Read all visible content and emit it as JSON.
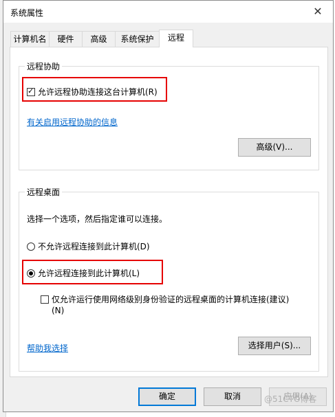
{
  "window": {
    "title": "系统属性",
    "close_glyph": "✕"
  },
  "tabs": [
    {
      "label": "计算机名"
    },
    {
      "label": "硬件"
    },
    {
      "label": "高级"
    },
    {
      "label": "系统保护"
    },
    {
      "label": "远程"
    }
  ],
  "remote_assistance": {
    "group_title": "远程协助",
    "allow_label": "允许远程协助连接这台计算机(R)",
    "allow_checked": true,
    "info_link": "有关启用远程协助的信息",
    "advanced_button": "高级(V)..."
  },
  "remote_desktop": {
    "group_title": "远程桌面",
    "instruction": "选择一个选项，然后指定谁可以连接。",
    "option_deny": "不允许远程连接到此计算机(D)",
    "option_allow": "允许远程连接到此计算机(L)",
    "selected": "allow",
    "nla_label_line1": "仅允许运行使用网络级别身份验证的远程桌面的计算机连接(建议)",
    "nla_label_line2": "(N)",
    "nla_checked": false,
    "help_link": "帮助我选择",
    "select_users_button": "选择用户(S)..."
  },
  "footer": {
    "ok": "确定",
    "cancel": "取消",
    "apply": "应用(A)"
  },
  "watermark": "@51CTO博客",
  "colors": {
    "highlight": "#e60000",
    "link": "#0066cc",
    "primary_border": "#0078d7"
  }
}
